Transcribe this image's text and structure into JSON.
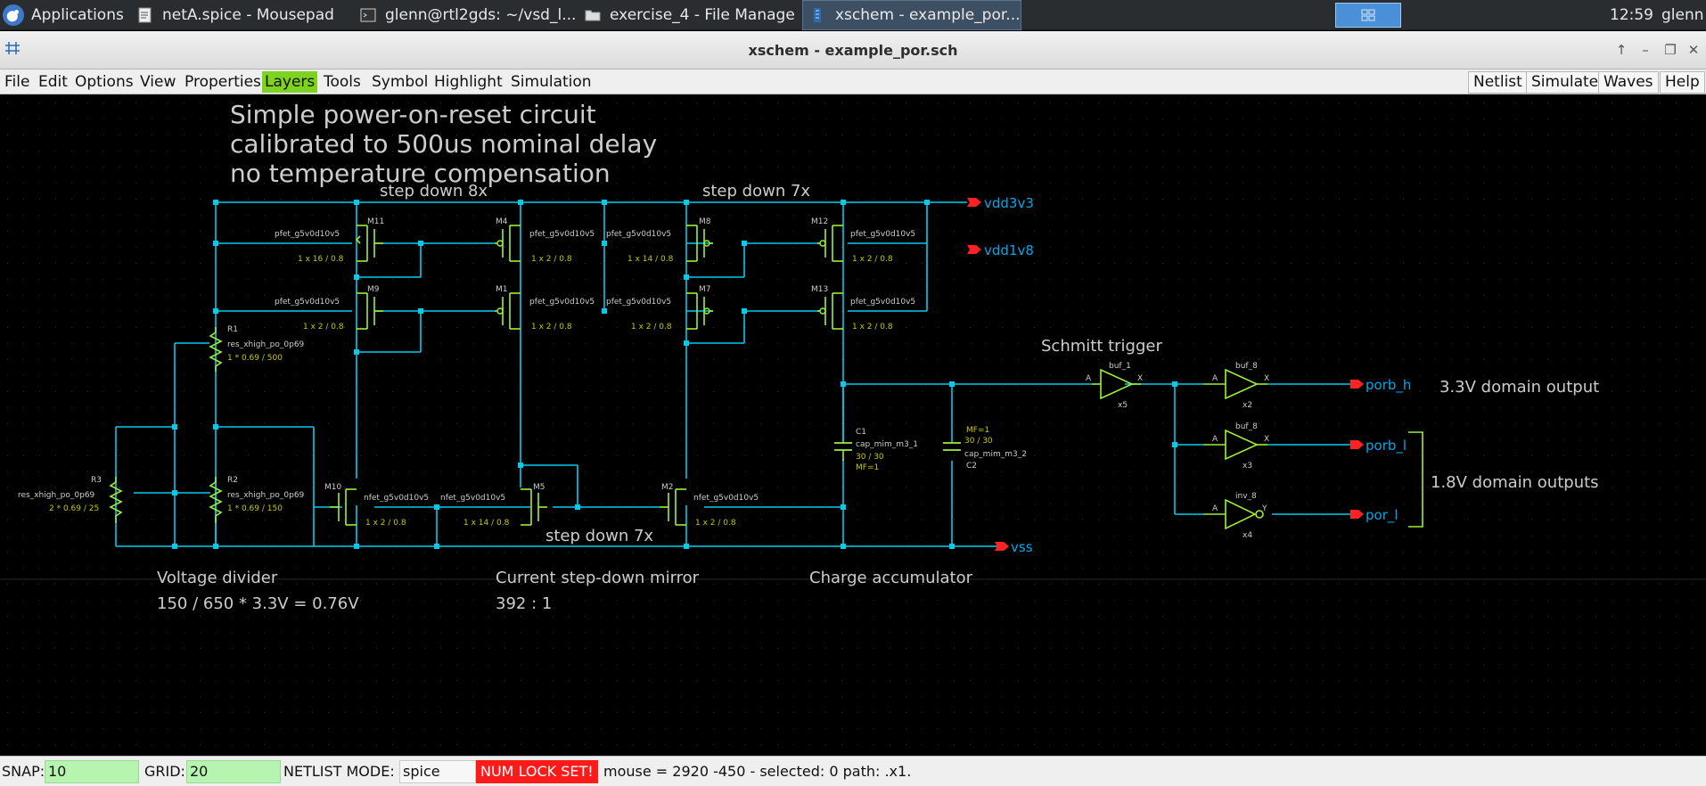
{
  "taskbar": {
    "apps_label": "Applications",
    "tasks": [
      {
        "label": "netA.spice - Mousepad",
        "icon": "text-editor-icon"
      },
      {
        "label": "glenn@rtl2gds: ~/vsd_l...",
        "icon": "terminal-icon"
      },
      {
        "label": "exercise_4 - File Manager",
        "icon": "folder-icon"
      },
      {
        "label": "xschem - example_por....",
        "icon": "xschem-icon"
      }
    ],
    "clock": "12:59",
    "user": "glenn"
  },
  "window": {
    "title": "xschem - example_por.sch"
  },
  "menubar": {
    "menus": [
      "File",
      "Edit",
      "Options",
      "View",
      "Properties",
      "Layers",
      "Tools",
      "Symbol",
      "Highlight",
      "Simulation"
    ],
    "buttons": [
      "Netlist",
      "Simulate",
      "Waves",
      "Help"
    ]
  },
  "schematic": {
    "title_lines": [
      "Simple power-on-reset circuit",
      "calibrated to 500us nominal delay",
      "no temperature compensation"
    ],
    "section_labels": {
      "step_down_8x": "step down 8x",
      "step_down_7x_top": "step down 7x",
      "step_down_7x_bottom": "step down 7x",
      "schmitt_trigger": "Schmitt trigger",
      "domain_33": "3.3V domain output",
      "domain_18": "1.8V domain outputs",
      "voltage_divider": "Voltage divider",
      "voltage_divider_eq": "150 / 650 * 3.3V = 0.76V",
      "mirror": "Current step-down mirror",
      "mirror_ratio": "392 : 1",
      "charge_acc": "Charge accumulator"
    },
    "pins": {
      "vdd3v3": "vdd3v3",
      "vdd1v8": "vdd1v8",
      "vss": "vss",
      "porb_h": "porb_h",
      "porb_l": "porb_l",
      "por_l": "por_l"
    },
    "pmos": [
      {
        "name": "M11",
        "model": "pfet_g5v0d10v5",
        "size": "1 x 16 / 0.8"
      },
      {
        "name": "M4",
        "model": "pfet_g5v0d10v5",
        "size": "1 x 2 / 0.8"
      },
      {
        "name": "M8",
        "model": "pfet_g5v0d10v5",
        "size": "1 x 14 / 0.8"
      },
      {
        "name": "M12",
        "model": "pfet_g5v0d10v5",
        "size": "1 x 2 / 0.8"
      },
      {
        "name": "M9",
        "model": "pfet_g5v0d10v5",
        "size": "1 x 2 / 0.8"
      },
      {
        "name": "M1",
        "model": "pfet_g5v0d10v5",
        "size": "1 x 2 / 0.8"
      },
      {
        "name": "M7",
        "model": "pfet_g5v0d10v5",
        "size": "1 x 2 / 0.8"
      },
      {
        "name": "M13",
        "model": "pfet_g5v0d10v5",
        "size": "1 x 2 / 0.8"
      }
    ],
    "nmos": [
      {
        "name": "M10",
        "model": "nfet_g5v0d10v5",
        "size": "1 x 2 / 0.8"
      },
      {
        "name": "M5",
        "model": "nfet_g5v0d10v5",
        "size": "1 x 14 / 0.8"
      },
      {
        "name": "M2",
        "model": "nfet_g5v0d10v5",
        "size": "1 x 2 / 0.8"
      }
    ],
    "resistors": [
      {
        "name": "R1",
        "model": "res_xhigh_po_0p69",
        "size": "1 * 0.69 / 500"
      },
      {
        "name": "R2",
        "model": "res_xhigh_po_0p69",
        "size": "1 * 0.69 / 150"
      },
      {
        "name": "R3",
        "model": "res_xhigh_po_0p69",
        "size": "2 * 0.69 / 25"
      }
    ],
    "capacitors": [
      {
        "name": "C1",
        "model": "cap_mim_m3_1",
        "size": "30 / 30",
        "mf": "MF=1"
      },
      {
        "name": "C2",
        "model": "cap_mim_m3_2",
        "size": "30 / 30",
        "mf": "MF=1"
      }
    ],
    "gates": [
      {
        "name": "buf_1",
        "inst": "x5",
        "in": "A",
        "out": "X"
      },
      {
        "name": "buf_8",
        "inst": "x2",
        "in": "A",
        "out": "X"
      },
      {
        "name": "buf_8",
        "inst": "x3",
        "in": "A",
        "out": "X"
      },
      {
        "name": "inv_8",
        "inst": "x4",
        "in": "A",
        "out": "Y"
      }
    ]
  },
  "statusbar": {
    "snap_label": "SNAP:",
    "snap_value": "10",
    "grid_label": "GRID:",
    "grid_value": "20",
    "netlist_mode_label": "NETLIST MODE:",
    "netlist_mode_value": "spice",
    "num_lock": "NUM LOCK SET!",
    "mouse_info": "mouse = 2920 -450 - selected: 0 path: .x1."
  },
  "colors": {
    "wire": "#00ccee",
    "device": "#9cf038",
    "pin": "#ff2222",
    "text": "#cccccc",
    "pin_label": "#00a8e8"
  }
}
